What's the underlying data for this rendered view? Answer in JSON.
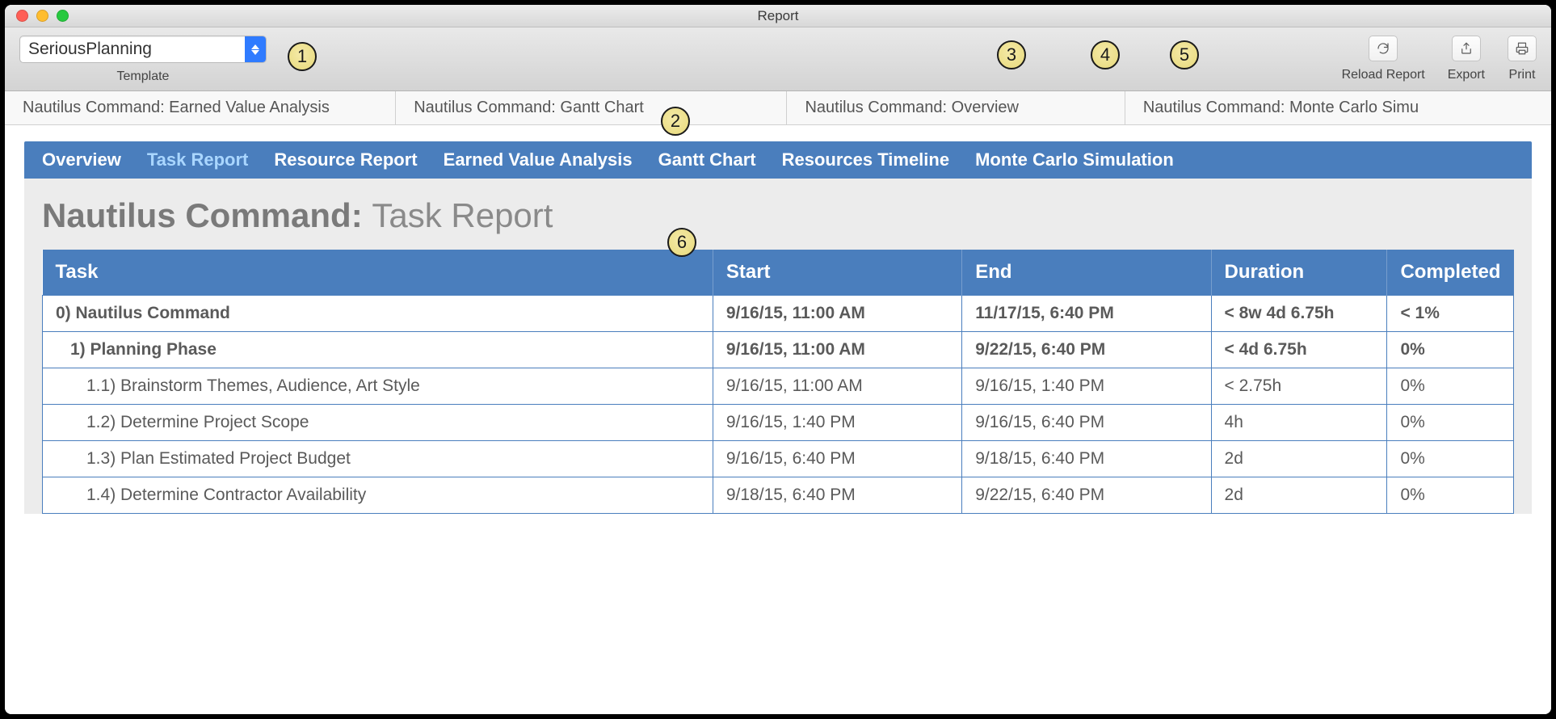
{
  "window": {
    "title": "Report"
  },
  "toolbar": {
    "template": {
      "value": "SeriousPlanning",
      "label": "Template"
    },
    "reload_label": "Reload Report",
    "export_label": "Export",
    "print_label": "Print"
  },
  "doc_tabs": [
    "Nautilus Command: Earned Value Analysis",
    "Nautilus Command: Gantt Chart",
    "Nautilus Command: Overview",
    "Nautilus Command: Monte Carlo Simu"
  ],
  "report_nav": [
    {
      "label": "Overview",
      "active": false
    },
    {
      "label": "Task Report",
      "active": true
    },
    {
      "label": "Resource Report",
      "active": false
    },
    {
      "label": "Earned Value Analysis",
      "active": false
    },
    {
      "label": "Gantt Chart",
      "active": false
    },
    {
      "label": "Resources Timeline",
      "active": false
    },
    {
      "label": "Monte Carlo Simulation",
      "active": false
    }
  ],
  "report_title": {
    "project": "Nautilus Command:",
    "section": "Task Report"
  },
  "table": {
    "headers": [
      "Task",
      "Start",
      "End",
      "Duration",
      "Completed"
    ],
    "rows": [
      {
        "lvl": 0,
        "task": "0) Nautilus Command",
        "start": "9/16/15, 11:00 AM",
        "end": "11/17/15, 6:40 PM",
        "dur": "< 8w 4d 6.75h",
        "comp": "< 1%"
      },
      {
        "lvl": 1,
        "task": "1) Planning Phase",
        "start": "9/16/15, 11:00 AM",
        "end": "9/22/15, 6:40 PM",
        "dur": "< 4d 6.75h",
        "comp": "0%"
      },
      {
        "lvl": 2,
        "task": "1.1) Brainstorm Themes, Audience, Art Style",
        "start": "9/16/15, 11:00 AM",
        "end": "9/16/15, 1:40 PM",
        "dur": "< 2.75h",
        "comp": "0%"
      },
      {
        "lvl": 2,
        "task": "1.2) Determine Project Scope",
        "start": "9/16/15, 1:40 PM",
        "end": "9/16/15, 6:40 PM",
        "dur": "4h",
        "comp": "0%"
      },
      {
        "lvl": 2,
        "task": "1.3) Plan Estimated Project Budget",
        "start": "9/16/15, 6:40 PM",
        "end": "9/18/15, 6:40 PM",
        "dur": "2d",
        "comp": "0%"
      },
      {
        "lvl": 2,
        "task": "1.4) Determine Contractor Availability",
        "start": "9/18/15, 6:40 PM",
        "end": "9/22/15, 6:40 PM",
        "dur": "2d",
        "comp": "0%"
      }
    ]
  },
  "callouts": [
    "1",
    "2",
    "3",
    "4",
    "5",
    "6"
  ]
}
